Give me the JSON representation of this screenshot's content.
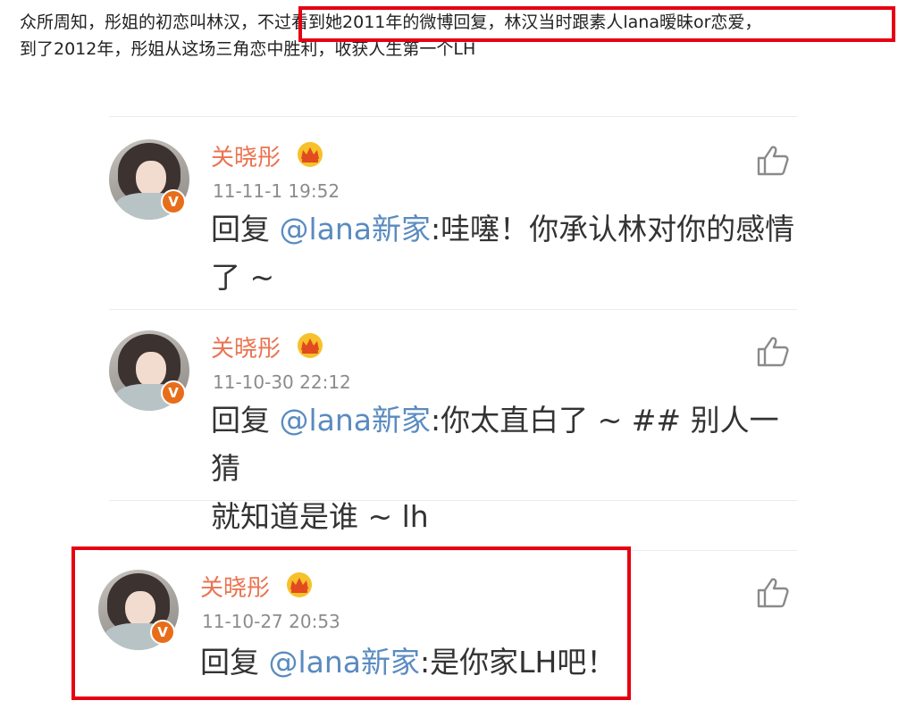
{
  "intro": {
    "line1_before": "众所周知，彤姐的初恋叫林汉，",
    "line1_highlight": "不过看到她2011年的微博回复，林汉当时跟素人lana暧昧or恋爱，",
    "line2": "到了2012年，彤姐从这场三角恋中胜利，收获人生第一个LH"
  },
  "colors": {
    "highlight_border": "#e60012",
    "username": "#eb7350",
    "mention": "#5a8bc0",
    "verified_badge": "#e86d1a"
  },
  "comments": [
    {
      "username": "关晓彤",
      "time": "11-11-1 19:52",
      "reply_prefix": "回复 ",
      "mention": "@lana新家",
      "line1_rest": ":哇噻！你承认林对你的感情",
      "line2": "了 ~",
      "badge": "V",
      "icons": [
        "avatar",
        "crown-icon",
        "verified-badge-icon",
        "like-icon"
      ]
    },
    {
      "username": "关晓彤",
      "time": "11-10-30 22:12",
      "reply_prefix": "回复 ",
      "mention": "@lana新家",
      "line1_rest": ":你太直白了 ~ ## 别人一猜",
      "line2": "就知道是谁 ~ lh",
      "badge": "V",
      "icons": [
        "avatar",
        "crown-icon",
        "verified-badge-icon",
        "like-icon"
      ]
    },
    {
      "username": "关晓彤",
      "time": "11-10-27 20:53",
      "reply_prefix": "回复 ",
      "mention": "@lana新家",
      "line1_rest": ":是你家LH吧！",
      "line2": "",
      "badge": "V",
      "icons": [
        "avatar",
        "crown-icon",
        "verified-badge-icon",
        "like-icon"
      ]
    }
  ]
}
